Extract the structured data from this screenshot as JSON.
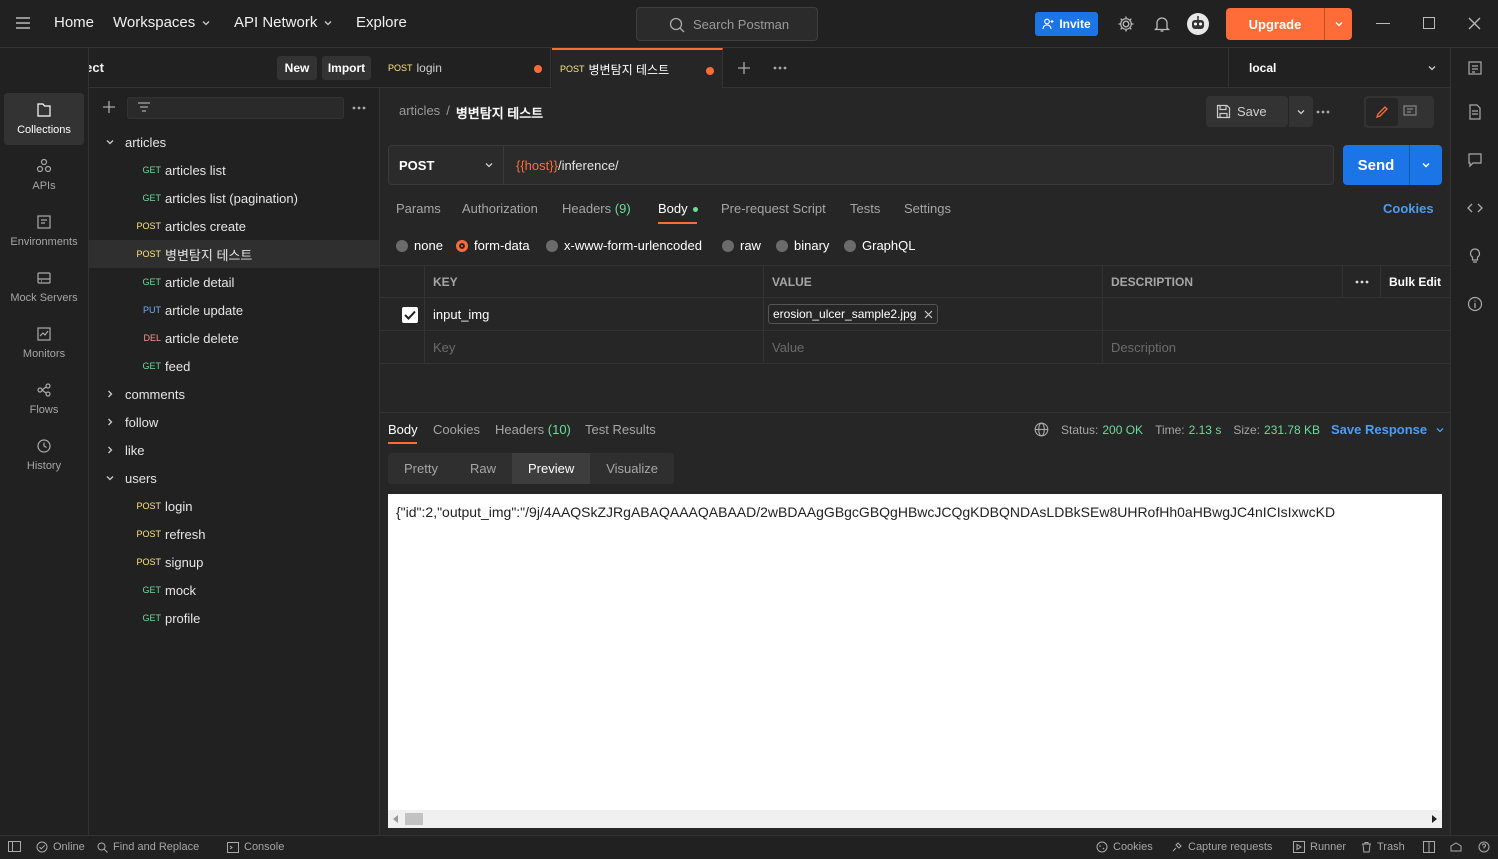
{
  "topbar": {
    "nav": [
      "Home",
      "Workspaces",
      "API Network",
      "Explore"
    ],
    "search_placeholder": "Search Postman",
    "invite_label": "Invite",
    "upgrade_label": "Upgrade"
  },
  "workspace": {
    "name": "drf_project",
    "new_label": "New",
    "import_label": "Import"
  },
  "rail": [
    {
      "label": "Collections",
      "icon": "collections-icon"
    },
    {
      "label": "APIs",
      "icon": "apis-icon"
    },
    {
      "label": "Environments",
      "icon": "environments-icon"
    },
    {
      "label": "Mock Servers",
      "icon": "mock-servers-icon"
    },
    {
      "label": "Monitors",
      "icon": "monitors-icon"
    },
    {
      "label": "Flows",
      "icon": "flows-icon"
    },
    {
      "label": "History",
      "icon": "history-icon"
    }
  ],
  "tree": {
    "articles": "articles",
    "items": [
      {
        "method": "GET",
        "name": "articles list"
      },
      {
        "method": "GET",
        "name": "articles list (pagination)"
      },
      {
        "method": "POST",
        "name": "articles create"
      },
      {
        "method": "POST",
        "name": "병변탐지 테스트"
      },
      {
        "method": "GET",
        "name": "article detail"
      },
      {
        "method": "PUT",
        "name": "article update"
      },
      {
        "method": "DEL",
        "name": "article delete"
      },
      {
        "method": "GET",
        "name": "feed"
      }
    ],
    "folders": [
      "comments",
      "follow",
      "like"
    ],
    "users": "users",
    "user_items": [
      {
        "method": "POST",
        "name": "login"
      },
      {
        "method": "POST",
        "name": "refresh"
      },
      {
        "method": "POST",
        "name": "signup"
      },
      {
        "method": "GET",
        "name": "mock"
      },
      {
        "method": "GET",
        "name": "profile"
      }
    ]
  },
  "tabs": [
    {
      "method": "POST",
      "name": "login"
    },
    {
      "method": "POST",
      "name": "병변탐지 테스트"
    }
  ],
  "environment": "local",
  "request": {
    "breadcrumb_parent": "articles",
    "breadcrumb_sep": "/",
    "breadcrumb_current": "병변탐지 테스트",
    "save_label": "Save",
    "method": "POST",
    "url_var": "{{host}}",
    "url_path": "/inference/",
    "send_label": "Send",
    "tabs": {
      "params": "Params",
      "auth": "Authorization",
      "headers": "Headers",
      "headers_count": "(9)",
      "body": "Body",
      "prereq": "Pre-request Script",
      "tests": "Tests",
      "settings": "Settings",
      "cookies": "Cookies"
    },
    "body_types": [
      "none",
      "form-data",
      "x-www-form-urlencoded",
      "raw",
      "binary",
      "GraphQL"
    ],
    "table": {
      "key_header": "KEY",
      "value_header": "VALUE",
      "desc_header": "DESCRIPTION",
      "bulk_edit": "Bulk Edit",
      "row_key": "input_img",
      "row_value": "erosion_ulcer_sample2.jpg",
      "key_placeholder": "Key",
      "value_placeholder": "Value",
      "desc_placeholder": "Description"
    }
  },
  "response": {
    "tabs": {
      "body": "Body",
      "cookies": "Cookies",
      "headers": "Headers",
      "headers_count": "(10)",
      "tests": "Test Results"
    },
    "status_label": "Status:",
    "status_value": "200 OK",
    "time_label": "Time:",
    "time_value": "2.13 s",
    "size_label": "Size:",
    "size_value": "231.78 KB",
    "save_response": "Save Response",
    "view_tabs": [
      "Pretty",
      "Raw",
      "Preview",
      "Visualize"
    ],
    "preview_text": "{\"id\":2,\"output_img\":\"/9j/4AAQSkZJRgABAQAAAQABAAD/2wBDAAgGBgcGBQgHBwcJCQgKDBQNDAsLDBkSEw8UHRofHh0aHBwgJC4nICIsIxwcKD"
  },
  "statusbar": {
    "online": "Online",
    "find": "Find and Replace",
    "console": "Console",
    "cookies": "Cookies",
    "capture": "Capture requests",
    "runner": "Runner",
    "trash": "Trash"
  },
  "colors": {
    "accent": "#ff6c37",
    "primary": "#1c75e6",
    "get": "#6bdd9a",
    "post": "#ffe47e",
    "put": "#74aef6",
    "delete": "#f79a8e",
    "success": "#6bdd9a"
  }
}
